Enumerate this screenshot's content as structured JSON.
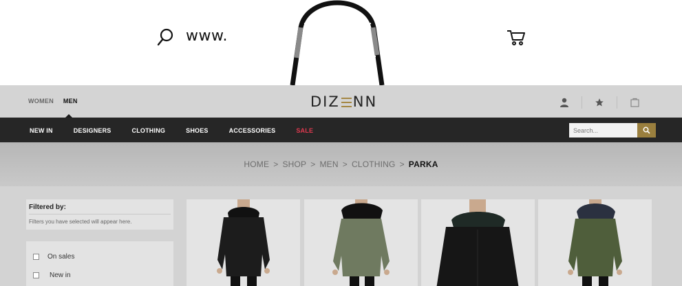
{
  "hero": {
    "url_text": "www.",
    "search_icon": "search-icon",
    "bag_graphic": "shopping-bag-handle-graphic",
    "cart_icon": "cart-icon"
  },
  "header": {
    "genders": [
      "WOMEN",
      "MEN"
    ],
    "active_gender": "MEN",
    "logo": {
      "left": "DIZ",
      "right": "NN"
    },
    "icons": [
      "user-icon",
      "star-icon",
      "bag-icon"
    ]
  },
  "nav": {
    "items": [
      "NEW IN",
      "DESIGNERS",
      "CLOTHING",
      "SHOES",
      "ACCESSORIES",
      "SALE"
    ],
    "sale_color": "#e0394f",
    "search_placeholder": "Search...",
    "search_button_color": "#9a7f3e"
  },
  "breadcrumb": {
    "items": [
      "HOME",
      "SHOP",
      "MEN",
      "CLOTHING"
    ],
    "separator": ">",
    "current": "PARKA"
  },
  "filters": {
    "title": "Filtered by:",
    "note": "Filters you have selected will appear here.",
    "options": [
      "On sales",
      "New in"
    ]
  },
  "products": [
    {
      "name": "black parka with black fur hood",
      "coat_color": "#1c1c1c",
      "fur_color": "#111111"
    },
    {
      "name": "olive parka with black fur hood",
      "coat_color": "#6f7a60",
      "fur_color": "#111111"
    },
    {
      "name": "black parka with dark green fur hood",
      "coat_color": "#161616",
      "fur_color": "#1f2a26"
    },
    {
      "name": "green parka with navy fur hood",
      "coat_color": "#4f5e3b",
      "fur_color": "#2b3140"
    }
  ],
  "colors": {
    "accent_gold": "#a48642",
    "nav_bg": "#262626",
    "header_bg": "#d4d4d4"
  }
}
